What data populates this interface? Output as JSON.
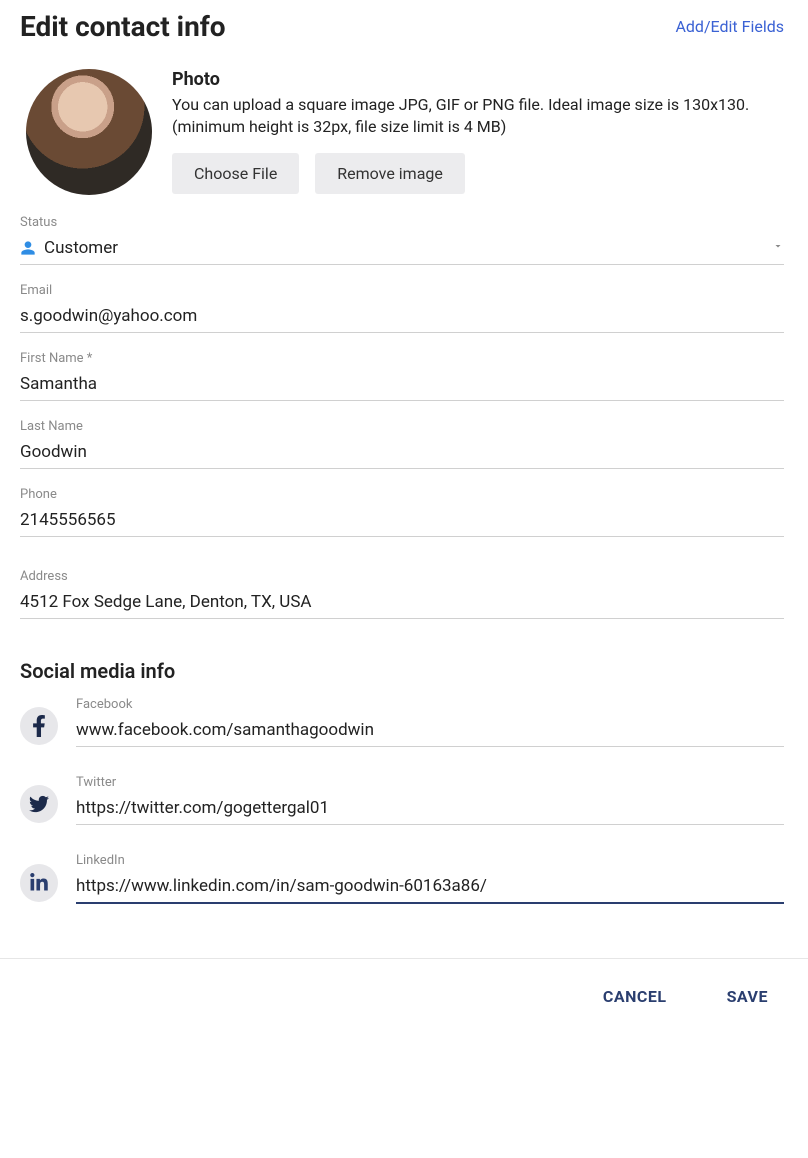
{
  "header": {
    "title": "Edit contact info",
    "editFieldsLink": "Add/Edit Fields"
  },
  "photo": {
    "heading": "Photo",
    "description": "You can upload a square image JPG, GIF or PNG file. Ideal image size is 130x130. (minimum height is 32px, file size limit is 4 MB)",
    "chooseFile": "Choose File",
    "removeImage": "Remove image"
  },
  "fields": {
    "status": {
      "label": "Status",
      "value": "Customer"
    },
    "email": {
      "label": "Email",
      "value": "s.goodwin@yahoo.com"
    },
    "firstName": {
      "label": "First Name *",
      "value": "Samantha"
    },
    "lastName": {
      "label": "Last Name",
      "value": "Goodwin"
    },
    "phone": {
      "label": "Phone",
      "value": "2145556565"
    },
    "address": {
      "label": "Address",
      "value": "4512 Fox Sedge Lane, Denton, TX, USA"
    }
  },
  "socialHeading": "Social media info",
  "social": {
    "facebook": {
      "label": "Facebook",
      "value": "www.facebook.com/samanthagoodwin"
    },
    "twitter": {
      "label": "Twitter",
      "value": "https://twitter.com/gogettergal01"
    },
    "linkedin": {
      "label": "LinkedIn",
      "value": "https://www.linkedin.com/in/sam-goodwin-60163a86/"
    }
  },
  "footer": {
    "cancel": "CANCEL",
    "save": "SAVE"
  }
}
